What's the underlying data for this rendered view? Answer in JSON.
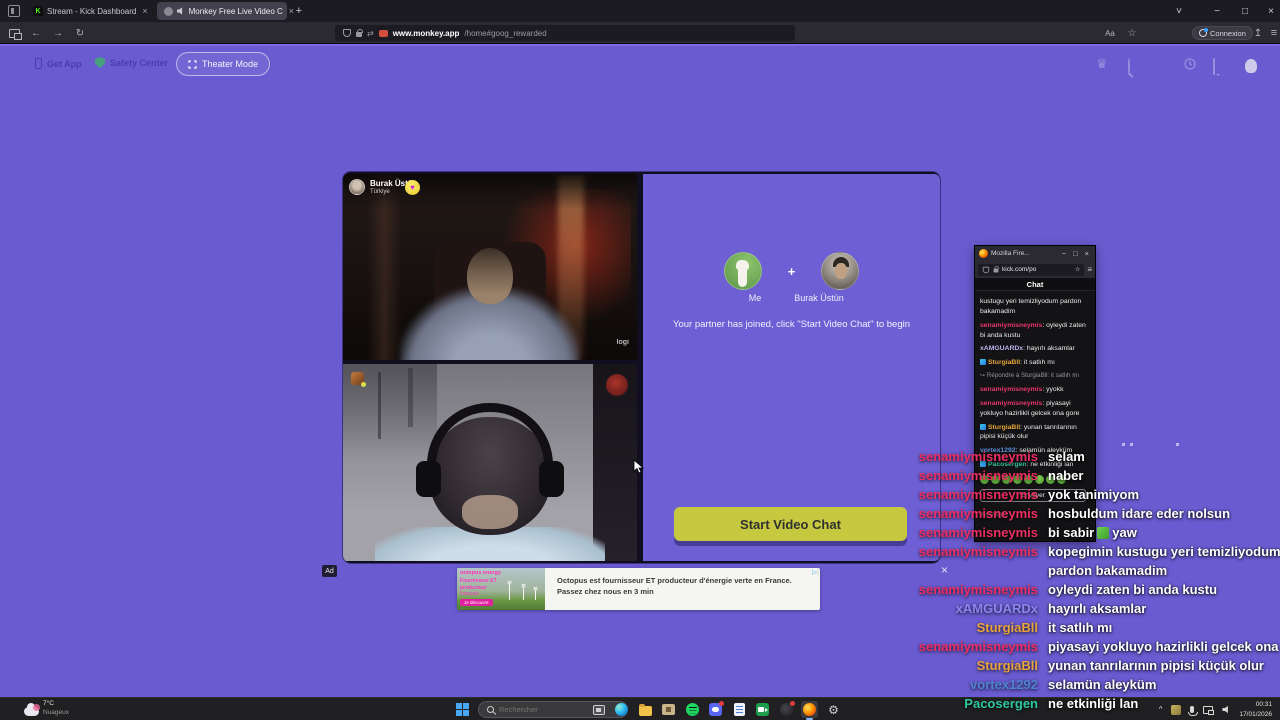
{
  "browser": {
    "tabs": [
      {
        "title": "Stream - Kick Dashboard",
        "favicon": "K"
      },
      {
        "title": "Monkey Free Live Video C"
      }
    ],
    "url": {
      "domain": "www.monkey.app",
      "path": "/home#goog_rewarded"
    },
    "connexion_label": "Connexion"
  },
  "icons": {
    "chevron_down": "˅",
    "minimize": "−",
    "maximize": "□",
    "close": "×",
    "back": "←",
    "forward": "→",
    "reload": "↻",
    "star": "☆",
    "menu": "≡",
    "new_tab": "+",
    "translate": "Aa",
    "download": "↥",
    "crown": "♛",
    "heart": "♥",
    "reply_arrow": "↪",
    "tray_chevron": "^",
    "adchoices": "▷",
    "kebab": "⋮",
    "swap": "⇄"
  },
  "monkey": {
    "toolbar": {
      "get_app": "Get App",
      "safety_center": "Safety Center",
      "theater_mode": "Theater Mode"
    },
    "stream": {
      "partner_name": "Burak Üstün",
      "partner_country": "Türkiye",
      "watermark": "logi"
    },
    "panel": {
      "me_label": "Me",
      "plus": "+",
      "partner_label": "Burak Üstün",
      "joined_text": "Your partner has joined, click \"Start Video Chat\" to begin",
      "start_button": "Start Video Chat"
    }
  },
  "ad": {
    "badge": "Ad",
    "brand": "octopus energy",
    "tagline_line1": "Fournisseur ET",
    "tagline_line2": "producteur",
    "tagline_line3": "français",
    "cta": "Je découvre",
    "body": "Octopus est fournisseur ET producteur d'énergie verte en France. Passez chez nous en 3 min"
  },
  "kick_window": {
    "title": "Mozilla Fire...",
    "url": "kick.com/po",
    "chat_header": "Chat",
    "messages": [
      {
        "user": "",
        "color": "",
        "text": "kustugu yeri temizliyodum pardon bakamadim"
      },
      {
        "user": "senamiymisneymis",
        "color": "#e8356d",
        "text": "oyleydi zaten bi anda kustu"
      },
      {
        "user": "xAMGUARDx",
        "color": "#b9b4f0",
        "text": "hayırlı aksamlar"
      },
      {
        "user": "SturgiaBll",
        "color": "#e7a43c",
        "text": "it satlıh mı"
      },
      {
        "user": "",
        "color": "#97959e",
        "text": "Répondre à SturgiaBll: it satlıh mı"
      },
      {
        "user": "senamiymisneymis",
        "color": "#e8356d",
        "text": "yyokk"
      },
      {
        "user": "senamiymisneymis",
        "color": "#e8356d",
        "text": "piyasayi yokluyo hazirlikli gelcek ona gore"
      },
      {
        "user": "SturgiaBll",
        "color": "#e7a43c",
        "text": "yunan tanrılarının pipisi küçük olur"
      },
      {
        "user": "vortex1292",
        "color": "#5b8fd9",
        "text": "selamün aleyküm"
      },
      {
        "user": "Pacosergen",
        "color": "#2ec7a0",
        "text": "ne etkinliği lan"
      }
    ],
    "send_button": "Envoyer",
    "input_placeholder": "message"
  },
  "overlay_chat": {
    "messages": [
      {
        "user": "senamiymisneymis",
        "color": "#ec2e63",
        "text": "selam"
      },
      {
        "user": "senamiymisneymis",
        "color": "#ec2e63",
        "text": "naber"
      },
      {
        "user": "senamiymisneymis",
        "color": "#ec2e63",
        "text": "yok tanimiyom"
      },
      {
        "user": "senamiymisneymis",
        "color": "#ec2e63",
        "text": "hosbuldum idare eder nolsun"
      },
      {
        "user": "senamiymisneymis",
        "color": "#ec2e63",
        "text": "bi sabir",
        "text_after_emoji": "yaw"
      },
      {
        "user": "senamiymisneymis",
        "color": "#ec2e63",
        "text": "kopegimin kustugu yeri temizliyodum"
      },
      {
        "user": "",
        "color": "",
        "text": "pardon bakamadim"
      },
      {
        "user": "senamiymisneymis",
        "color": "#ec2e63",
        "text": "oyleydi zaten bi anda kustu"
      },
      {
        "user": "xAMGUARDx",
        "color": "#8b86ef",
        "text": "hayırlı aksamlar"
      },
      {
        "user": "SturgiaBll",
        "color": "#e8a33d",
        "text": "it satlıh mı"
      },
      {
        "user": "senamiymisneymis",
        "color": "#ec2e63",
        "text": "piyasayi yokluyo hazirlikli gelcek ona gore"
      },
      {
        "user": "SturgiaBll",
        "color": "#e8a33d",
        "text": "yunan tanrılarının pipisi küçük olur"
      },
      {
        "user": "vortex1292",
        "color": "#4f83d4",
        "text": "selamün aleyküm"
      },
      {
        "user": "Pacosergen",
        "color": "#2ec7a0",
        "text": "ne etkinliği lan"
      }
    ]
  },
  "taskbar": {
    "weather": {
      "temp": "7°C",
      "condition": "Nuageux"
    },
    "search_placeholder": "Rechercher",
    "clock": {
      "time": "00:31",
      "date": "17/01/2026"
    }
  }
}
